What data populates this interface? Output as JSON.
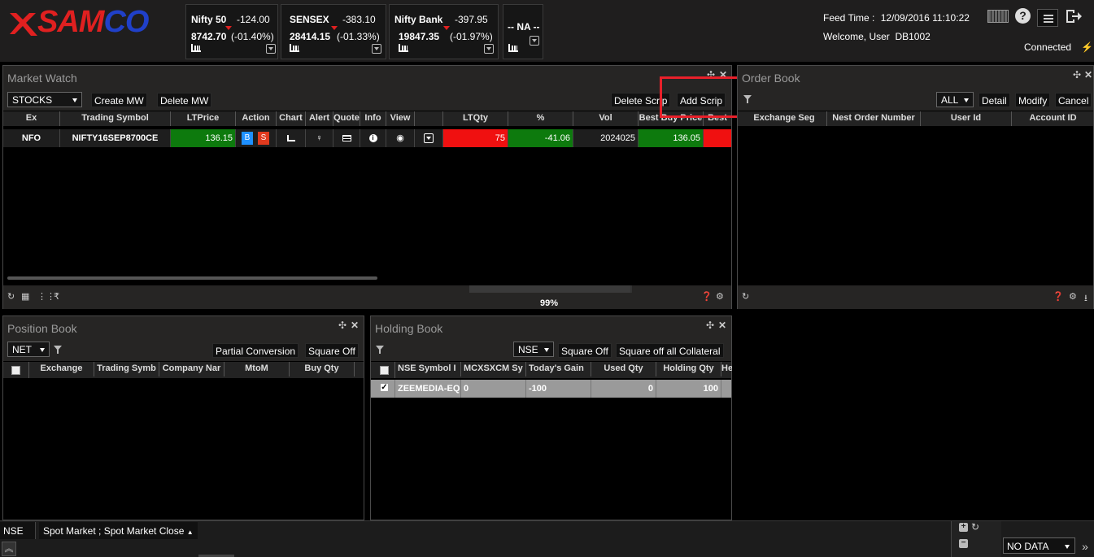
{
  "header": {
    "logo": "SAMCO",
    "tickers": [
      {
        "name": "Nifty 50",
        "change": "-124.00",
        "price": "8742.70",
        "pct": "(-01.40%)"
      },
      {
        "name": "SENSEX",
        "change": "-383.10",
        "price": "28414.15",
        "pct": "(-01.33%)"
      },
      {
        "name": "Nifty Bank",
        "change": "-397.95",
        "price": "19847.35",
        "pct": "(-01.97%)"
      },
      {
        "name": "-- NA --",
        "change": "",
        "price": "",
        "pct": ""
      }
    ],
    "feed_label": "Feed Time :",
    "feed_time": "12/09/2016 11:10:22",
    "welcome": "Welcome, User  DB1002",
    "connection": "Connected",
    "colors": {
      "down": "#e02020",
      "up": "#2ecc40"
    }
  },
  "market_watch": {
    "title": "Market Watch",
    "list_selected": "STOCKS",
    "create_label": "Create MW",
    "delete_label": "Delete MW",
    "delete_scrip_label": "Delete Scrip",
    "add_scrip_label": "Add Scrip",
    "columns": [
      "Ex",
      "Trading Symbol",
      "LTPrice",
      "Action",
      "Chart",
      "Alert",
      "Quote",
      "Info",
      "View",
      "",
      "LTQty",
      "%",
      "Vol",
      "Best Buy Price",
      "Best"
    ],
    "row": {
      "ex": "NFO",
      "symbol": "NIFTY16SEP8700CE",
      "ltp": "136.15",
      "buy": "B",
      "sell": "S",
      "ltqty": "75",
      "pct": "-41.06",
      "vol": "2024025",
      "best_buy": "136.05"
    },
    "progress": "99%",
    "progress_value": 0.99
  },
  "order_book": {
    "title": "Order Book",
    "filter_selected": "ALL",
    "detail_label": "Detail",
    "modify_label": "Modify",
    "cancel_label": "Cancel",
    "columns": [
      "Exchange Seg",
      "Nest Order Number",
      "User Id",
      "Account ID"
    ]
  },
  "position_book": {
    "title": "Position Book",
    "filter_selected": "NET",
    "partial_label": "Partial Conversion",
    "square_off_label": "Square Off",
    "columns": [
      "Exchange",
      "Trading Symb",
      "Company Nar",
      "MtoM",
      "Buy Qty"
    ]
  },
  "holding_book": {
    "title": "Holding Book",
    "exchange_selected": "NSE",
    "square_off_label": "Square Off",
    "square_off_all_label": "Square off all Collateral",
    "columns": [
      "NSE Symbol I",
      "MCXSXCM Sy",
      "Today's Gain",
      "Used Qty",
      "Holding Qty",
      "He"
    ],
    "row": {
      "symbol": "ZEEMEDIA-EQ",
      "mcx": "0",
      "gain": "-100",
      "used": "0",
      "holding": "100"
    }
  },
  "status_bar": {
    "exchange": "NSE",
    "market_status": "Spot Market ; Spot Market Close",
    "no_data": "NO DATA"
  }
}
